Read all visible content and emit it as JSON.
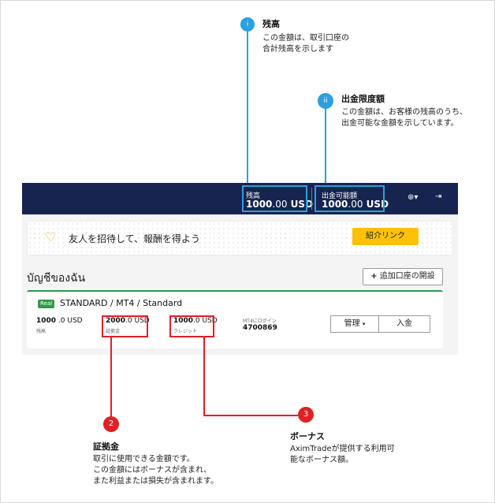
{
  "annotations": {
    "i": {
      "marker": "i",
      "title": "残高",
      "text_line1": "この金額は、取引口座の",
      "text_line2": "合計残高を示します"
    },
    "ii": {
      "marker": "ii",
      "title": "出金限度額",
      "text_line1": "この金額は、お客様の残高のうち、",
      "text_line2": "出金可能な金額を示しています。"
    },
    "two": {
      "marker": "2",
      "title": "証拠金",
      "text_line1": "取引に使用できる金額です。",
      "text_line2": "この金額にはボーナスが含まれ、",
      "text_line3": "また利益または損失が含まれます。"
    },
    "three": {
      "marker": "3",
      "title": "ボーナス",
      "text_line1": "AximTradeが提供する利用可",
      "text_line2": "能なボーナス額。"
    }
  },
  "navbar": {
    "balance_label": "残高",
    "balance_int": "1000",
    "balance_dec": ".00",
    "balance_ccy": " USD",
    "withdraw_label": "出金可能額",
    "withdraw_int": "1000",
    "withdraw_dec": ".00",
    "withdraw_ccy": " USD",
    "language_icon": "globe-icon",
    "language_glyph": "⊕▾",
    "logout_icon": "logout-icon",
    "logout_glyph": "⇥"
  },
  "referral": {
    "text": "友人を招待して、報酬を得よう",
    "button": "紹介リンク",
    "icon": "heart-outline-icon"
  },
  "accounts": {
    "title": "บัญชีของฉัน",
    "add_button": "追加口座の開設",
    "add_icon_glyph": "+"
  },
  "account_card": {
    "badge": "Real",
    "title": "STANDARD / MT4 / Standard",
    "metrics": [
      {
        "int": "1000",
        "dec": " .0 USD",
        "label": "残高"
      },
      {
        "int": "2000",
        "dec": ".0 USD",
        "label": "証拠金"
      },
      {
        "int": "1000",
        "dec": ".0 USD",
        "label": "クレジット"
      },
      {
        "int": "4700869",
        "dec": "",
        "label": "MT4にログイン"
      }
    ],
    "manage_button": "管理",
    "manage_caret": "▾",
    "deposit_button": "入金"
  },
  "colors": {
    "navbar": "#16244f",
    "accent_blue": "#2b9fe0",
    "accent_red": "#e02024",
    "referral_button": "#ffc107",
    "real_badge": "#2e9a4a"
  }
}
